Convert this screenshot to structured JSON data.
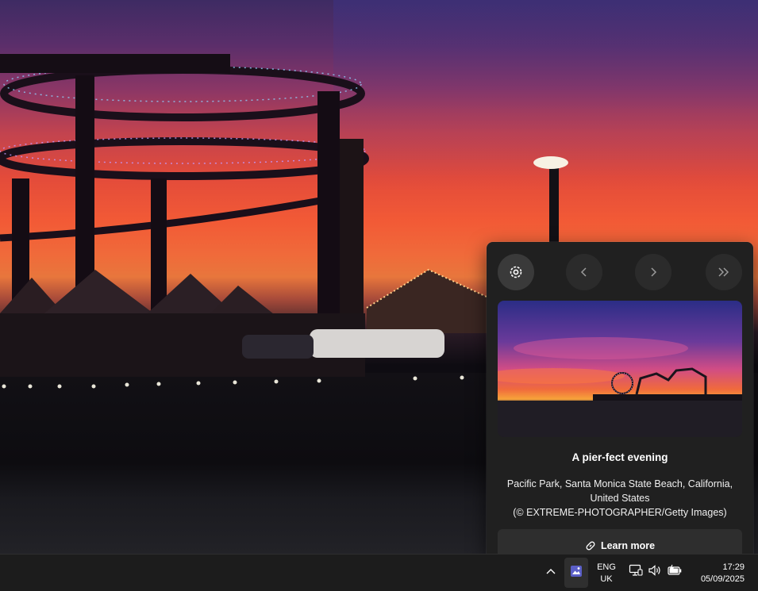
{
  "wallpaper": {
    "description_icon": "pacific-park-pier-sunset"
  },
  "flyout": {
    "buttons": {
      "settings_icon": "gear-icon",
      "previous_icon": "chevron-left-icon",
      "next_icon": "chevron-right-icon",
      "skip_icon": "double-chevron-right-icon"
    },
    "title": "A pier-fect evening",
    "caption_line1": "Pacific Park, Santa Monica State Beach, California,",
    "caption_line2": "United States",
    "caption_line3": "(© EXTREME-PHOTOGRAPHER/Getty Images)",
    "learn_more": "Learn more"
  },
  "taskbar": {
    "language_line1": "ENG",
    "language_line2": "UK",
    "time": "17:29",
    "date": "05/09/2025"
  },
  "colors": {
    "panel_bg": "#202020",
    "taskbar_bg": "#1c1c1c",
    "spotlight_icon": "#5b5fc7"
  }
}
